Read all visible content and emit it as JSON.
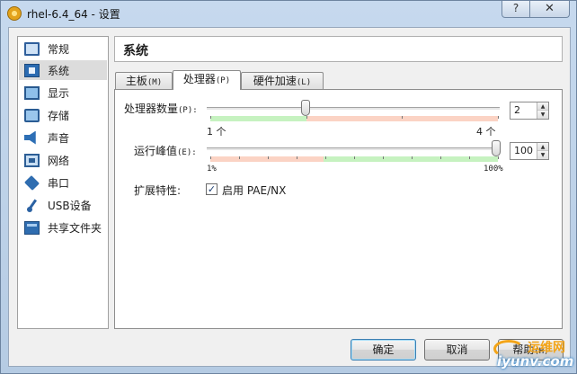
{
  "window": {
    "title": "rhel-6.4_64 - 设置",
    "help_glyph": "?",
    "close_glyph": "✕"
  },
  "sidebar": {
    "items": [
      {
        "label": "常规",
        "icon": "general-icon",
        "selected": false
      },
      {
        "label": "系统",
        "icon": "system-icon",
        "selected": true
      },
      {
        "label": "显示",
        "icon": "display-icon",
        "selected": false
      },
      {
        "label": "存储",
        "icon": "storage-icon",
        "selected": false
      },
      {
        "label": "声音",
        "icon": "audio-icon",
        "selected": false
      },
      {
        "label": "网络",
        "icon": "network-icon",
        "selected": false
      },
      {
        "label": "串口",
        "icon": "serial-port-icon",
        "selected": false
      },
      {
        "label": "USB设备",
        "icon": "usb-icon",
        "selected": false
      },
      {
        "label": "共享文件夹",
        "icon": "shared-folder-icon",
        "selected": false
      }
    ]
  },
  "page": {
    "title": "系统"
  },
  "tabs": [
    {
      "label": "主板",
      "mnemonic": "(M)",
      "active": false
    },
    {
      "label": "处理器",
      "mnemonic": "(P)",
      "active": true
    },
    {
      "label": "硬件加速",
      "mnemonic": "(L)",
      "active": false
    }
  ],
  "processor": {
    "count_label": "处理器数量",
    "count_mnemonic": "(P):",
    "count_value": "2",
    "count_min_label": "1  个",
    "count_max_label": "4  个",
    "count_min": 1,
    "count_max": 4,
    "count_recommended_max": 2,
    "cap_label": "运行峰值",
    "cap_mnemonic": "(E):",
    "cap_value": "100",
    "cap_min_label": "1%",
    "cap_max_label": "100%",
    "cap_min": 1,
    "cap_max": 100,
    "extended_label": "扩展特性:",
    "pae_label": "启用 PAE/NX",
    "pae_checked": true
  },
  "buttons": {
    "ok": "确定",
    "cancel": "取消",
    "help": "帮助",
    "help_mnemonic": "(H)"
  },
  "watermark": {
    "text1": "运维网",
    "text2": "iyunv.com"
  },
  "colors": {
    "recommended": "#c6f2c0",
    "warning": "#fbd3c4",
    "title_bg": "#c2d7ed",
    "default_button_border": "#3c7fb1"
  }
}
